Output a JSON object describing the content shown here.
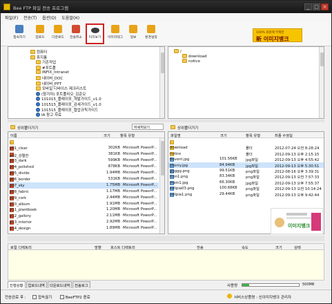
{
  "window": {
    "title": "Bee FTP 파일 전송 프로그램",
    "min_label": "_",
    "max_label": "□",
    "close_label": "×"
  },
  "menu": [
    "파일(F)",
    "전송(T)",
    "옵션(O)",
    "도움말(H)"
  ],
  "toolbar": {
    "buttons": [
      {
        "label": "접속하기",
        "color": "#4a7fc1",
        "icon": "connect-icon"
      },
      {
        "label": "업로드",
        "color": "#e8a317",
        "icon": "upload-icon"
      },
      {
        "label": "다운로드",
        "color": "#e8a317",
        "icon": "download-icon"
      },
      {
        "label": "전송취소",
        "color": "#d24a2f",
        "icon": "cancel-icon"
      },
      {
        "label": "미리보기",
        "color": "#3b3b3b",
        "icon": "eye-icon"
      },
      {
        "label": "이미지태그",
        "color": "#e8a317",
        "icon": "image-tag-icon"
      },
      {
        "label": "정보",
        "color": "#e8a317",
        "icon": "info-icon"
      },
      {
        "label": "환경설정",
        "color": "#e8a317",
        "icon": "settings-icon"
      }
    ]
  },
  "ad_top": {
    "small": "100% 회원제 무제한",
    "brand": "新 이미지뱅크"
  },
  "local_tree": [
    {
      "label": "컴퓨터",
      "type": "computer",
      "depth": 0
    },
    {
      "label": "휴지통",
      "type": "folder",
      "depth": 0
    },
    {
      "label": "기존작업",
      "type": "folder",
      "depth": 1
    },
    {
      "label": "#포트폴",
      "type": "folder",
      "depth": 1
    },
    {
      "label": "INFIX_Intranet",
      "type": "folder",
      "depth": 1
    },
    {
      "label": "네이버_DOC",
      "type": "folder",
      "depth": 1
    },
    {
      "label": "네이버_PPT",
      "type": "folder",
      "depth": 1
    },
    {
      "label": "모바일 디바이스 제크리스트",
      "type": "folder",
      "depth": 1
    },
    {
      "label": "(참가자) 포트폴리오_김준오",
      "type": "earth",
      "depth": 1
    },
    {
      "label": "101015_플레이포_개발가이드_v1.0",
      "type": "earth",
      "depth": 1
    },
    {
      "label": "101515_플레이포_감세가이드_v1.0",
      "type": "earth",
      "depth": 1
    },
    {
      "label": "101515_플레이포_협업규칙가이드",
      "type": "earth",
      "depth": 1
    },
    {
      "label": "IA 참고 자료",
      "type": "earth",
      "depth": 1
    }
  ],
  "remote_tree": [
    {
      "label": "/"
    },
    {
      "label": "download"
    },
    {
      "label": "notice"
    }
  ],
  "local_pathbar": {
    "label": "상위폴더가기",
    "view": "자세히보기"
  },
  "remote_pathbar": {
    "label": "상위폴더가기"
  },
  "local_columns": [
    "이름",
    "크기",
    "항목 유형"
  ],
  "local_files": [
    {
      "name": "..",
      "size": "",
      "type": "",
      "icon": "folder"
    },
    {
      "name": "p01_clear",
      "size": "302KB",
      "type": "Microsoft PowerP...",
      "icon": "pp"
    },
    {
      "name": "p02_강렬한",
      "size": "381KB",
      "type": "Microsoft PowerP...",
      "icon": "pp"
    },
    {
      "name": "p03_dark",
      "size": "599KB",
      "type": "Microsoft PowerP...",
      "icon": "pp"
    },
    {
      "name": "p04_polished",
      "size": "878KB",
      "type": "Microsoft PowerP...",
      "icon": "pp"
    },
    {
      "name": "p05_divide",
      "size": "1.94MB",
      "type": "Microsoft PowerP...",
      "icon": "pp"
    },
    {
      "name": "p06_border",
      "size": "531KB",
      "type": "Microsoft PowerP...",
      "icon": "pp"
    },
    {
      "name": "p07_sky",
      "size": "1.75MB",
      "type": "Microsoft PowerP...",
      "icon": "pp",
      "selected": true
    },
    {
      "name": "p08_fabric",
      "size": "1.17MB",
      "type": "Microsoft PowerP...",
      "icon": "pp"
    },
    {
      "name": "p09_cork",
      "size": "2.44MB",
      "type": "Microsoft PowerP...",
      "icon": "pp"
    },
    {
      "name": "p10_album",
      "size": "1.91MB",
      "type": "Microsoft PowerP...",
      "icon": "pp"
    },
    {
      "name": "p11_plantbook",
      "size": "1.20MB",
      "type": "Microsoft PowerP...",
      "icon": "pp"
    },
    {
      "name": "p12_gallery",
      "size": "2.11MB",
      "type": "Microsoft PowerP...",
      "icon": "pp"
    },
    {
      "name": "p13_interior",
      "size": "2.92MB",
      "type": "Microsoft PowerP...",
      "icon": "pp"
    },
    {
      "name": "p14_design",
      "size": "1.89MB",
      "type": "Microsoft PowerP...",
      "icon": "pp"
    }
  ],
  "remote_columns": [
    "파일명",
    "크기",
    "항목 유형",
    "최종 수정일"
  ],
  "remote_files": [
    {
      "name": "..",
      "size": "",
      "type": "",
      "date": "",
      "icon": "folder"
    },
    {
      "name": "download",
      "size": "",
      "type": "폴더",
      "date": "2012-07-24 오전 8:28:24",
      "icon": "folder"
    },
    {
      "name": "notice",
      "size": "",
      "type": "폴더",
      "date": "2012-09-13 오후 2:15:15",
      "icon": "folder"
    },
    {
      "name": "8event.jpg",
      "size": "101.56KB",
      "type": "jpg파일",
      "date": "2012-09-13 오후 4:55:42",
      "icon": "img"
    },
    {
      "name": "cherry.jpg",
      "size": "84.94KB",
      "type": "jpg파일",
      "date": "2012-09-13 오후 5:30:51",
      "icon": "img",
      "selected": true
    },
    {
      "name": "ggggg.png",
      "size": "99.51KB",
      "type": "png파일",
      "date": "2012-08-16 오후 3:39:31",
      "icon": "img"
    },
    {
      "name": "icon1.png",
      "size": "83.34KB",
      "type": "png파일",
      "date": "2012-09-13 오전 7:57:33",
      "icon": "img"
    },
    {
      "name": "main1.jpg",
      "size": "66.30KB",
      "type": "jpg파일",
      "date": "2012-09-13 오후 7:55:37",
      "icon": "img"
    },
    {
      "name": "sellpia03.png",
      "size": "100.68KB",
      "type": "png파일",
      "date": "2012-09-13 오전 10:14:24",
      "icon": "img"
    },
    {
      "name": "sellpia1.png",
      "size": "29.44KB",
      "type": "png파일",
      "date": "2012-09-13 오후 9:42:44",
      "icon": "img"
    }
  ],
  "ad_bottom": {
    "brand": "이미지뱅크"
  },
  "queue_columns": [
    "로컬 디렉토리",
    "방향",
    "호스트 디렉토리",
    "전송",
    "속도",
    "크기",
    "상태"
  ],
  "tabs": [
    "진행상황",
    "업로드내역",
    "다운로드내역",
    "전송로그"
  ],
  "usage": {
    "label": "사용량",
    "fraction": 0.12,
    "capacity": "500MB",
    "color": "#3fb24a"
  },
  "status": {
    "complete_label": "전송완료 후 :",
    "opt1": "접속끊기",
    "opt2": "BeeFTP2 종료",
    "service_label": "서비스상품명 : 신이미지뱅크 관리자"
  }
}
